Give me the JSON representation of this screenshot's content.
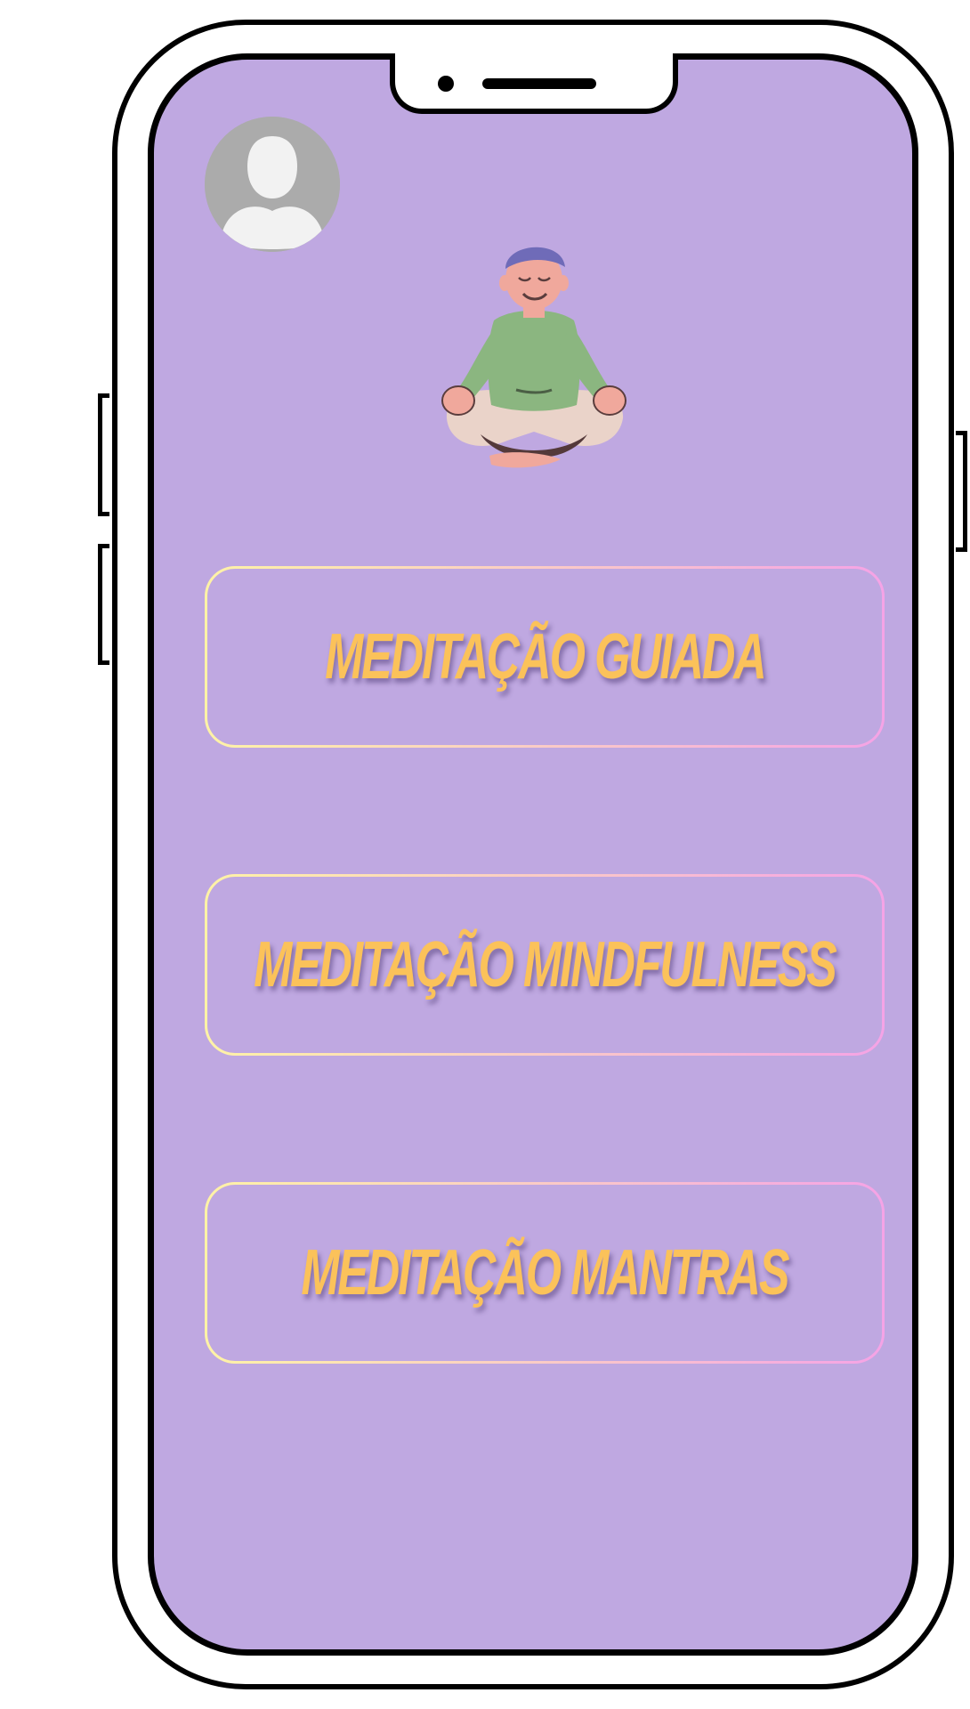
{
  "menu": [
    {
      "label": "MEDITAÇÃO GUIADA"
    },
    {
      "label": "MEDITAÇÃO MINDFULNESS"
    },
    {
      "label": "MEDITAÇÃO MANTRAS"
    }
  ],
  "icons": {
    "avatar": "user-avatar-icon",
    "illustration": "meditating-person-illustration"
  },
  "colors": {
    "screen_background": "#bfa8e1",
    "label_color": "#fbc25a",
    "border_gradient_start": "#fff3a6",
    "border_gradient_end": "#f5a3e6"
  }
}
